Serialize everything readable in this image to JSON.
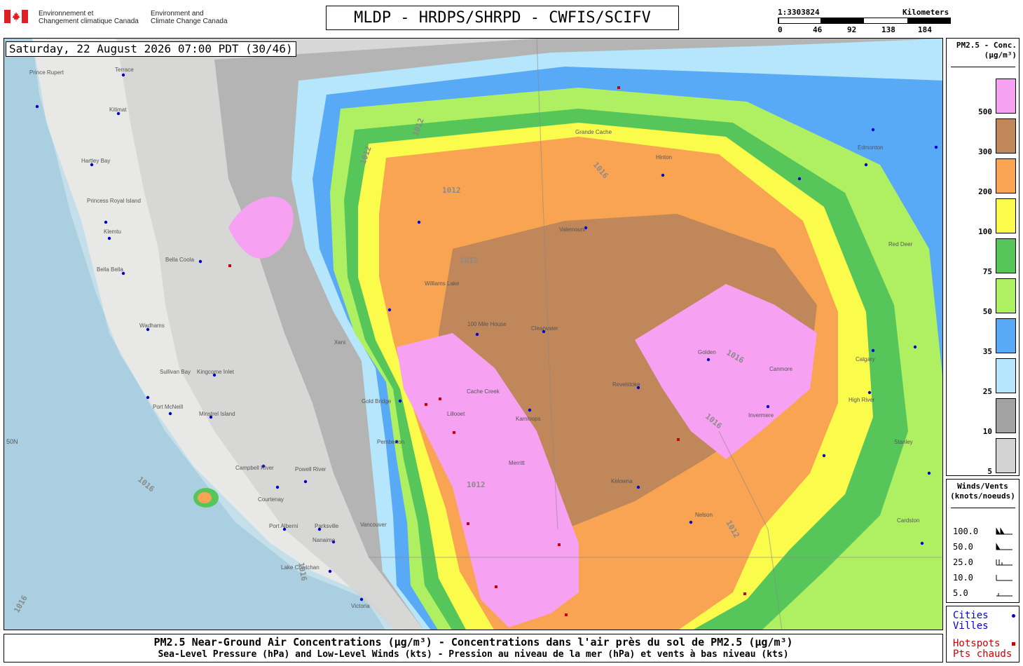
{
  "header": {
    "agency_fr": [
      "Environnement et",
      "Changement climatique Canada"
    ],
    "agency_en": [
      "Environment and",
      "Climate Change Canada"
    ],
    "title": "MLDP - HRDPS/SHRPD - CWFIS/SCIFV",
    "scale": {
      "ratio": "1:3303824",
      "unit": "Kilometers",
      "ticks": [
        "0",
        "46",
        "92",
        "138",
        "184"
      ]
    }
  },
  "map": {
    "timestamp": "Saturday, 22 August 2026 07:00 PDT (30/46)",
    "latitude_label": "50N",
    "isobar_labels": [
      "1012",
      "1012",
      "1012",
      "1016",
      "1016",
      "1016",
      "1016",
      "1012",
      "1016",
      "1016",
      "1012",
      "1012"
    ],
    "places": [
      {
        "name": "Prince Rupert"
      },
      {
        "name": "Terrace"
      },
      {
        "name": "Kitimat"
      },
      {
        "name": "Hartley Bay"
      },
      {
        "name": "Princess Royal Island"
      },
      {
        "name": "Klemtu"
      },
      {
        "name": "Bella Bella"
      },
      {
        "name": "Bella Coola"
      },
      {
        "name": "Wadhams"
      },
      {
        "name": "Sullivan Bay"
      },
      {
        "name": "Port McNeill"
      },
      {
        "name": "Kingcome Inlet"
      },
      {
        "name": "Minstrel Island"
      },
      {
        "name": "Campbell River"
      },
      {
        "name": "Powell River"
      },
      {
        "name": "Courtenay"
      },
      {
        "name": "Port Alberni"
      },
      {
        "name": "Parksville"
      },
      {
        "name": "Nanaimo"
      },
      {
        "name": "Lake Cowichan"
      },
      {
        "name": "Victoria"
      },
      {
        "name": "Vancouver"
      },
      {
        "name": "Xeni"
      },
      {
        "name": "Williams Lake"
      },
      {
        "name": "100 Mile House"
      },
      {
        "name": "Clearwater"
      },
      {
        "name": "Cache Creek"
      },
      {
        "name": "Kamloops"
      },
      {
        "name": "Lillooet"
      },
      {
        "name": "Merritt"
      },
      {
        "name": "Revelstoke"
      },
      {
        "name": "Golden"
      },
      {
        "name": "Invermere"
      },
      {
        "name": "Canmore"
      },
      {
        "name": "Calgary"
      },
      {
        "name": "High River"
      },
      {
        "name": "Red Deer"
      },
      {
        "name": "Edmonton"
      },
      {
        "name": "Hinton"
      },
      {
        "name": "Valemount"
      },
      {
        "name": "Grande Cache"
      },
      {
        "name": "Stanley"
      },
      {
        "name": "Cardston"
      },
      {
        "name": "Nelson"
      },
      {
        "name": "Kelowna"
      },
      {
        "name": "Pemberton"
      },
      {
        "name": "Gold Bridge"
      }
    ]
  },
  "legend_conc": {
    "title": [
      "PM2.5 - Conc.",
      "(µg/m³)"
    ],
    "levels": [
      {
        "label": "500",
        "color": "#f7a1f2"
      },
      {
        "label": "300",
        "color": "#c0875a"
      },
      {
        "label": "200",
        "color": "#f9a452"
      },
      {
        "label": "100",
        "color": "#fbfb4b"
      },
      {
        "label": "75",
        "color": "#56c65a"
      },
      {
        "label": "50",
        "color": "#aff062"
      },
      {
        "label": "35",
        "color": "#58a9f6"
      },
      {
        "label": "25",
        "color": "#b5e6fb"
      },
      {
        "label": "10",
        "color": "#a2a2a2"
      },
      {
        "label": "5",
        "color": "#d2d2d2"
      }
    ]
  },
  "legend_wind": {
    "title": [
      "Winds/Vents",
      "(knots/noeuds)"
    ],
    "speeds": [
      "100.0",
      "50.0",
      "25.0",
      "10.0",
      "5.0"
    ]
  },
  "legend_points": {
    "cities": [
      "Cities",
      "Villes"
    ],
    "cities_color": "#0000cc",
    "hotspots": [
      "Hotspots",
      "Pts chauds"
    ],
    "hotspots_color": "#cc0000"
  },
  "footer": {
    "line1": "PM2.5 Near-Ground Air Concentrations (µg/m³) - Concentrations dans l'air près du sol de PM2.5 (µg/m³)",
    "line2": "Sea-Level Pressure (hPa) and Low-Level Winds (kts) - Pression au niveau de la mer (hPa) et vents à bas niveau (kts)"
  }
}
